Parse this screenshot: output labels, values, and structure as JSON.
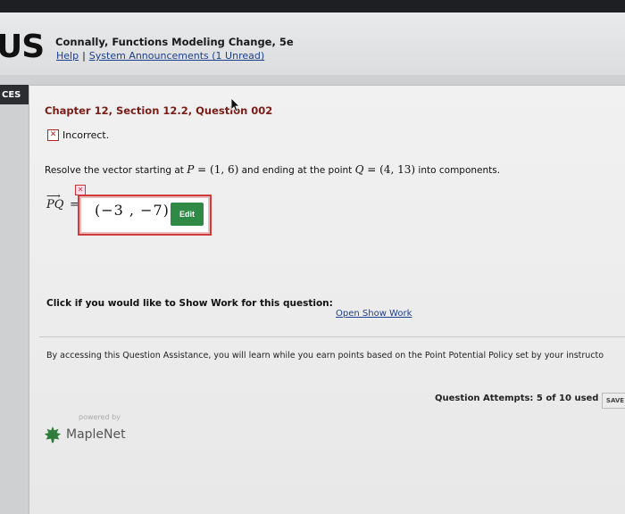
{
  "header": {
    "logo_text": "US",
    "book_title": "Connally, Functions Modeling Change, 5e",
    "help_link": "Help",
    "separator": "|",
    "announcements_link": "System Announcements (1 Unread)"
  },
  "side_tab": {
    "label": "CES"
  },
  "question": {
    "title": "Chapter 12, Section 12.2, Question 002",
    "status": "Incorrect.",
    "prompt_prefix": "Resolve the vector starting at ",
    "p_var": "P",
    "p_eq": " = ",
    "p_val": "(1, 6)",
    "mid_text": " and ending at the point ",
    "q_var": "Q",
    "q_eq": " = ",
    "q_val": "(4, 13)",
    "prompt_suffix": " into components.",
    "vector_label": "PQ",
    "equals": "=",
    "answer_value": "(−3 , −7)",
    "edit_label": "Edit"
  },
  "show_work": {
    "prompt": "Click if you would like to Show Work for this question:",
    "link": "Open Show Work"
  },
  "assistance": {
    "text": "By accessing this Question Assistance, you will learn while you earn points based on the Point Potential Policy set by your instructo"
  },
  "attempts": {
    "text": "Question Attempts: 5 of 10 used"
  },
  "save_button": {
    "label": "SAVE"
  },
  "footer": {
    "powered_by": "powered by",
    "brand": "MapleNet"
  },
  "colors": {
    "title_red": "#7a1d18",
    "error_red": "#d23b3b",
    "edit_green": "#2e8a45",
    "link_blue": "#1c3f8f"
  }
}
